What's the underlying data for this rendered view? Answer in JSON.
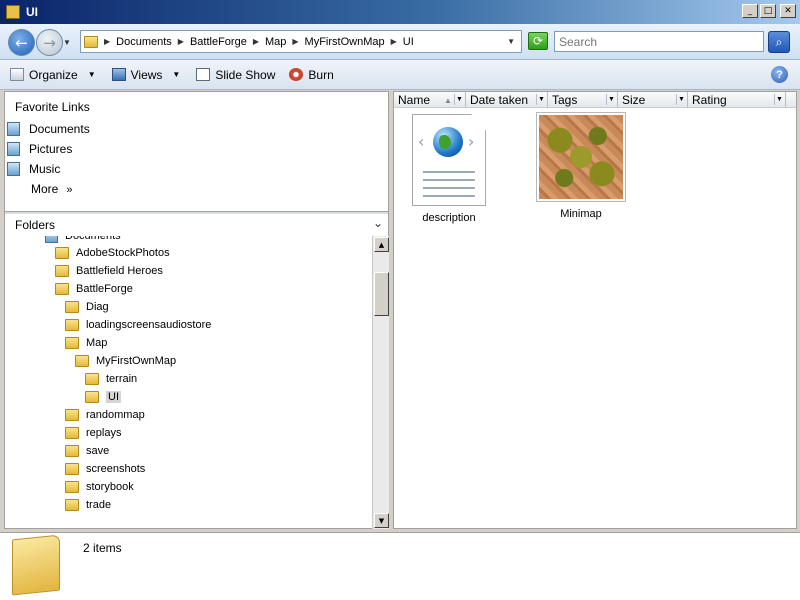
{
  "window": {
    "title": "UI"
  },
  "window_buttons": {
    "minimize": "_",
    "maximize": "□",
    "close": "✕"
  },
  "address": {
    "breadcrumb": [
      "Documents",
      "BattleForge",
      "Map",
      "MyFirstOwnMap",
      "UI"
    ],
    "search_placeholder": "Search"
  },
  "toolbar": {
    "organize": "Organize",
    "views": "Views",
    "slideshow": "Slide Show",
    "burn": "Burn"
  },
  "favorites": {
    "heading": "Favorite Links",
    "items": [
      "Documents",
      "Pictures",
      "Music"
    ],
    "more": "More"
  },
  "folders": {
    "heading": "Folders",
    "tree": [
      {
        "label": "Documents",
        "depth": 0,
        "icon": "documents-icon"
      },
      {
        "label": "AdobeStockPhotos",
        "depth": 1
      },
      {
        "label": "Battlefield Heroes",
        "depth": 1
      },
      {
        "label": "BattleForge",
        "depth": 1
      },
      {
        "label": "Diag",
        "depth": 2
      },
      {
        "label": "loadingscreensaudiostore",
        "depth": 2
      },
      {
        "label": "Map",
        "depth": 2
      },
      {
        "label": "MyFirstOwnMap",
        "depth": 3
      },
      {
        "label": "terrain",
        "depth": 4
      },
      {
        "label": "UI",
        "depth": 4,
        "selected": true
      },
      {
        "label": "randommap",
        "depth": 2
      },
      {
        "label": "replays",
        "depth": 2
      },
      {
        "label": "save",
        "depth": 2
      },
      {
        "label": "screenshots",
        "depth": 2
      },
      {
        "label": "storybook",
        "depth": 2
      },
      {
        "label": "trade",
        "depth": 2
      }
    ]
  },
  "columns": [
    "Name",
    "Date taken",
    "Tags",
    "Size",
    "Rating"
  ],
  "files": [
    {
      "label": "description",
      "icon": "html-file-icon"
    },
    {
      "label": "Minimap",
      "icon": "image-thumbnail"
    }
  ],
  "status": {
    "count": "2 items"
  },
  "colors": {
    "title_bar": "#0a246a",
    "accent": "#3a6ea5",
    "background": "#d4d0c8"
  }
}
